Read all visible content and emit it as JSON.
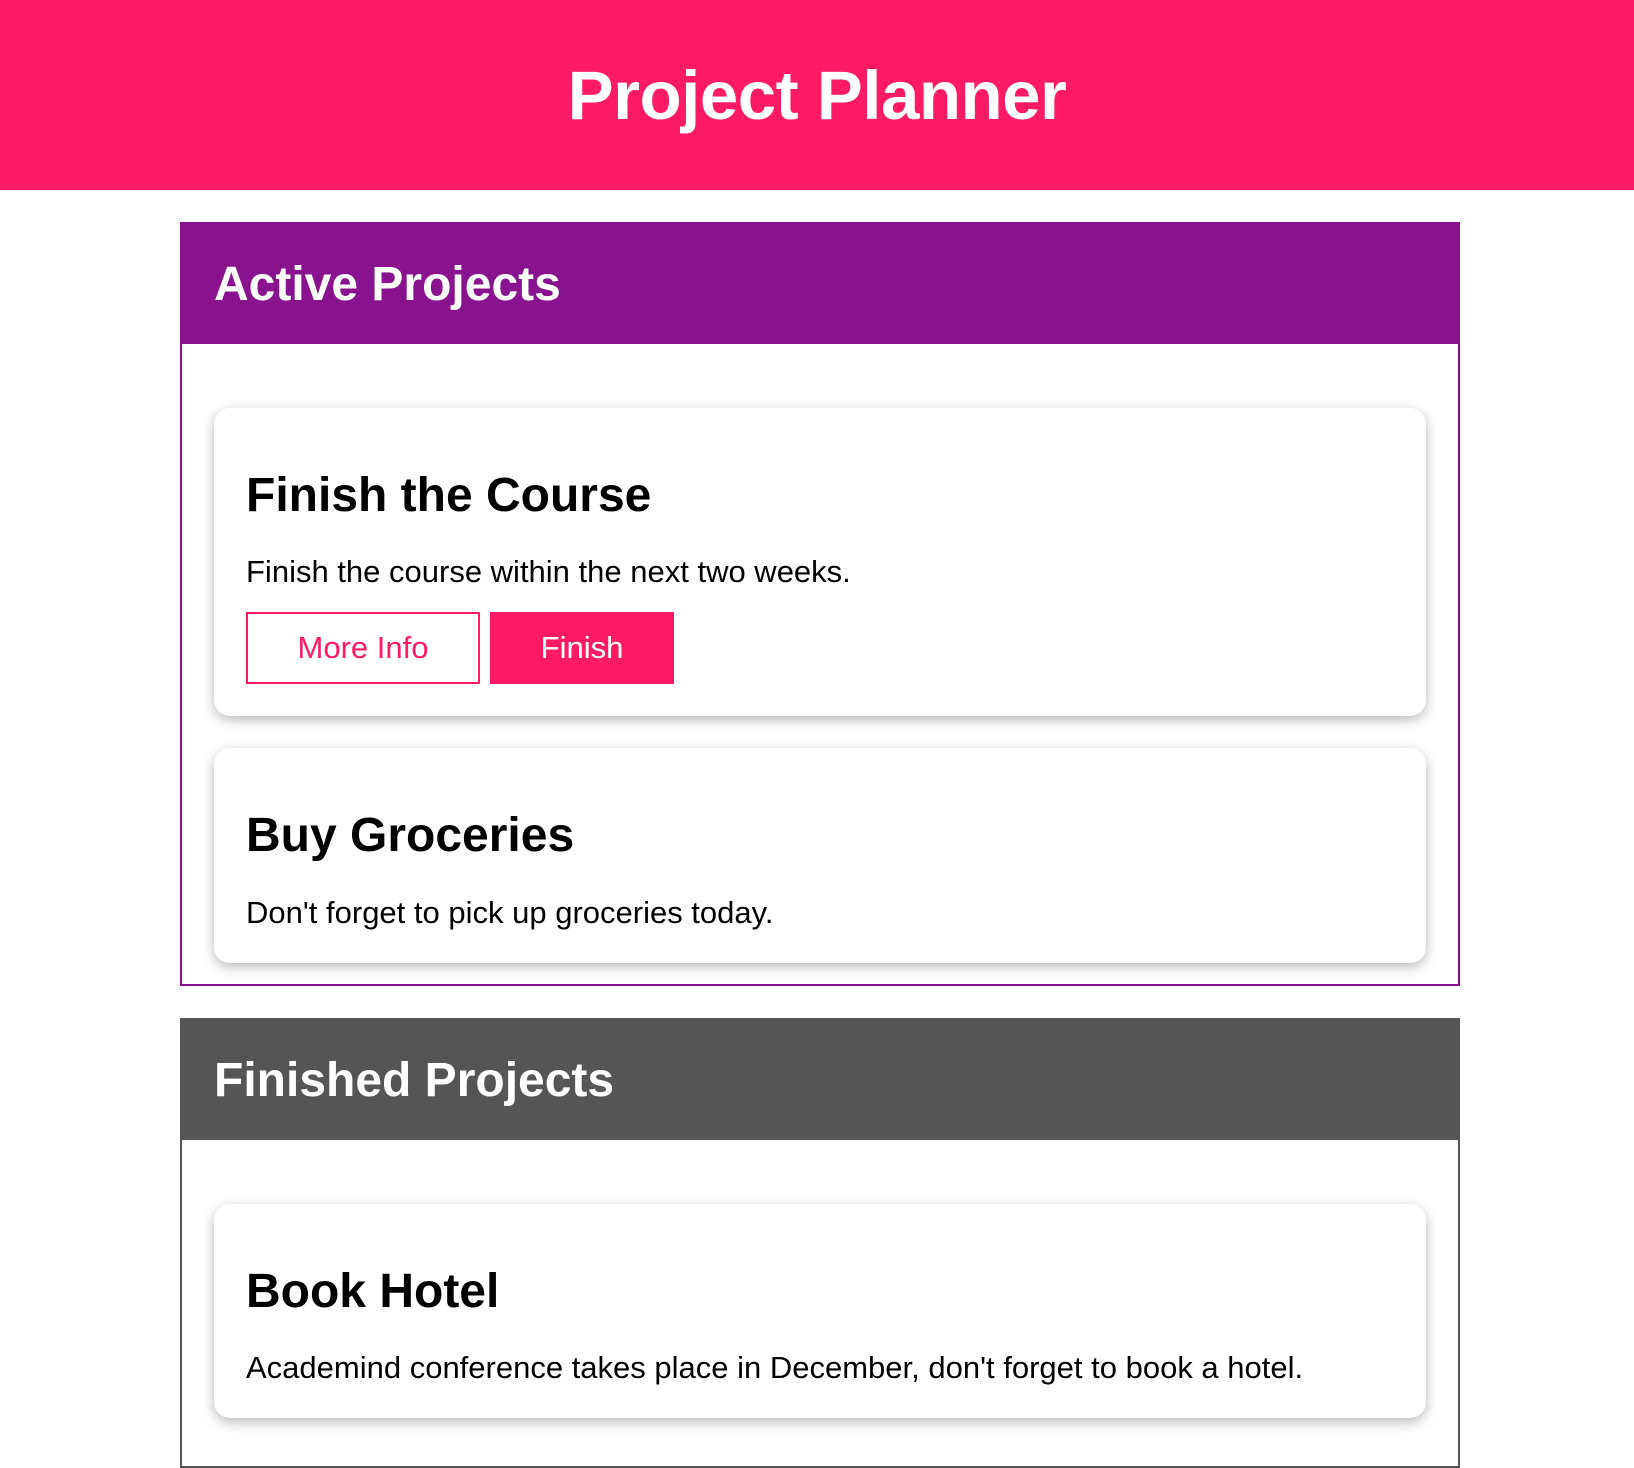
{
  "app": {
    "title": "Project Planner"
  },
  "sections": {
    "active": {
      "title": "Active Projects",
      "projects": [
        {
          "title": "Finish the Course",
          "description": "Finish the course within the next two weeks.",
          "more_info_label": "More Info",
          "action_label": "Finish"
        },
        {
          "title": "Buy Groceries",
          "description": "Don't forget to pick up groceries today."
        }
      ]
    },
    "finished": {
      "title": "Finished Projects",
      "projects": [
        {
          "title": "Book Hotel",
          "description": "Academind conference takes place in December, don't forget to book a hotel."
        }
      ]
    }
  },
  "colors": {
    "brand": "#ff1a66",
    "active_section": "#89138f",
    "finished_section": "#555555"
  }
}
